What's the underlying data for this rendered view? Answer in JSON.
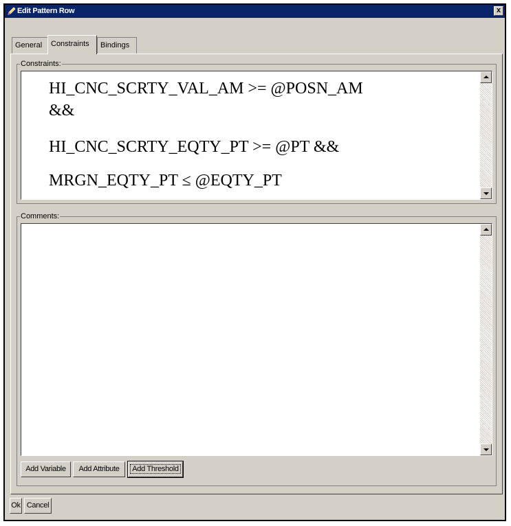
{
  "window": {
    "title": "Edit Pattern Row",
    "close_glyph": "x"
  },
  "tabs": [
    {
      "label": "General",
      "active": false
    },
    {
      "label": "Constraints",
      "active": true
    },
    {
      "label": "Bindings",
      "active": false
    }
  ],
  "constraints": {
    "group_label": "Constraints:",
    "lines": [
      "HI_CNC_SCRTY_VAL_AM >= @POSN_AM",
      "&&",
      "HI_CNC_SCRTY_EQTY_PT >= @PT &&",
      "MRGN_EQTY_PT ≤ @EQTY_PT"
    ]
  },
  "comments": {
    "group_label": "Comments:",
    "value": ""
  },
  "panel_buttons": {
    "add_variable": "Add Variable",
    "add_attribute": "Add Attribute",
    "add_threshold": "Add Threshold"
  },
  "dialog_buttons": {
    "ok": "Ok",
    "cancel": "Cancel"
  },
  "icons": {
    "app": "pencil-icon",
    "close": "close-icon",
    "scroll_up": "scroll-up-arrow-icon",
    "scroll_down": "scroll-down-arrow-icon"
  },
  "colors": {
    "titlebar": "#0a246a",
    "dialog_face": "#d4d0c8",
    "text_area": "#ffffff"
  }
}
